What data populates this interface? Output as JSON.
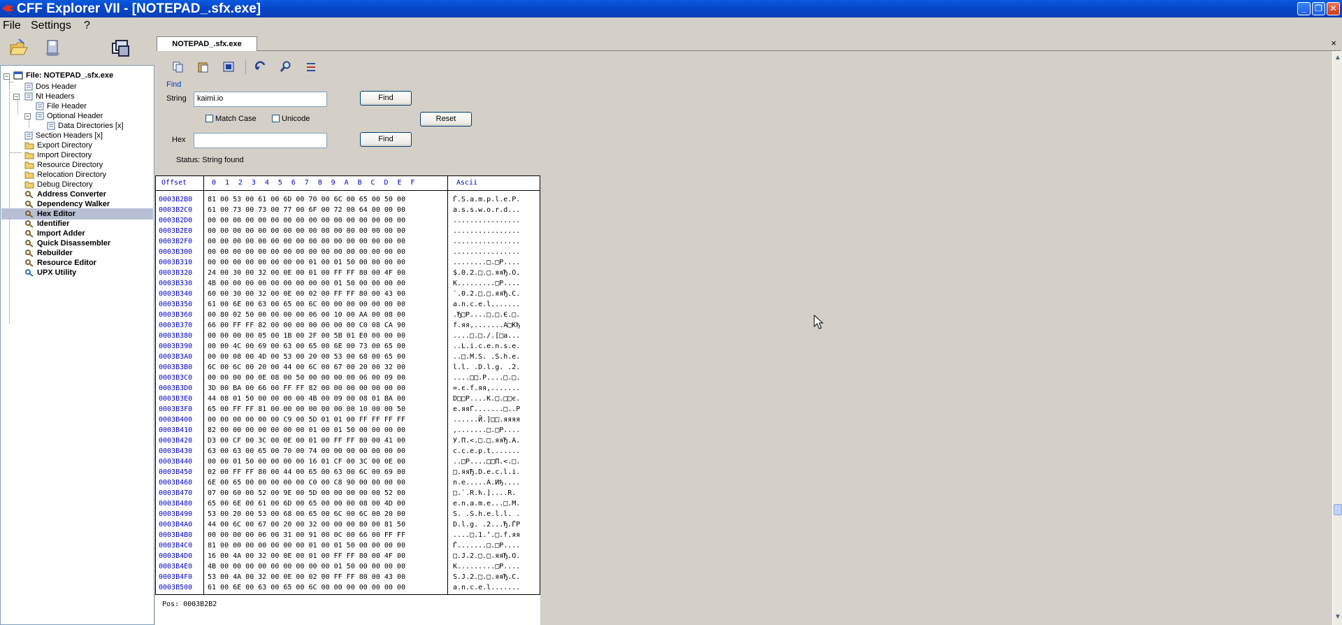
{
  "window": {
    "title": "CFF Explorer VII - [NOTEPAD_.sfx.exe]"
  },
  "menu": {
    "items": [
      "File",
      "Settings",
      "?"
    ]
  },
  "tab": {
    "label": "NOTEPAD_.sfx.exe",
    "close": "×"
  },
  "tree": {
    "root": "File: NOTEPAD_.sfx.exe",
    "items": [
      "Dos Header",
      "Nt Headers",
      "File Header",
      "Optional Header",
      "Data Directories [x]",
      "Section Headers [x]",
      "Export Directory",
      "Import Directory",
      "Resource Directory",
      "Relocation Directory",
      "Debug Directory",
      "Address Converter",
      "Dependency Walker",
      "Hex Editor",
      "Identifier",
      "Import Adder",
      "Quick Disassembler",
      "Rebuilder",
      "Resource Editor",
      "UPX Utility"
    ],
    "selected": "Hex Editor"
  },
  "find": {
    "group_label": "Find",
    "string_label": "String",
    "string_value": "kaimi.io",
    "find_label": "Find",
    "match_case_label": "Match Case",
    "unicode_label": "Unicode",
    "reset_label": "Reset",
    "hex_label": "Hex",
    "hex_value": "",
    "status": "Status: String found"
  },
  "hex": {
    "offset_header": "Offset",
    "byte_header": "0  1  2  3  4  5  6  7  8  9  A  B  C  D  E  F",
    "ascii_header": "Ascii",
    "rows": [
      {
        "offset": "0003B2B0",
        "hex": "81 00 53 00 61 00 6D 00 70 00 6C 00 65 00 50 00",
        "ascii": "Ѓ.S.a.m.p.l.e.P."
      },
      {
        "offset": "0003B2C0",
        "hex": "61 00 73 00 73 00 77 00 6F 00 72 00 64 00 00 00",
        "ascii": "a.s.s.w.o.r.d..."
      },
      {
        "offset": "0003B2D0",
        "hex": "00 00 00 00 00 00 00 00 00 00 00 00 00 00 00 00",
        "ascii": "................"
      },
      {
        "offset": "0003B2E0",
        "hex": "00 00 00 00 00 00 00 00 00 00 00 00 00 00 00 00",
        "ascii": "................"
      },
      {
        "offset": "0003B2F0",
        "hex": "00 00 00 00 00 00 00 00 00 00 00 00 00 00 00 00",
        "ascii": "................"
      },
      {
        "offset": "0003B300",
        "hex": "00 00 00 00 00 00 00 00 00 00 00 00 00 00 00 00",
        "ascii": "................"
      },
      {
        "offset": "0003B310",
        "hex": "00 00 00 00 00 00 00 00 01 00 01 50 00 00 00 00",
        "ascii": "........□.□P...."
      },
      {
        "offset": "0003B320",
        "hex": "24 00 30 00 32 00 0E 00 01 00 FF FF 80 00 4F 00",
        "ascii": "$.0.2.□.□.яяЂ.O."
      },
      {
        "offset": "0003B330",
        "hex": "4B 00 00 00 00 00 00 00 00 00 01 50 00 00 00 00",
        "ascii": "K.........□P...."
      },
      {
        "offset": "0003B340",
        "hex": "60 00 30 00 32 00 0E 00 02 00 FF FF 80 00 43 00",
        "ascii": "`.0.2.□.□.яяЂ.C."
      },
      {
        "offset": "0003B350",
        "hex": "61 00 6E 00 63 00 65 00 6C 00 00 00 00 00 00 00",
        "ascii": "a.n.c.e.l......."
      },
      {
        "offset": "0003B360",
        "hex": "00 80 02 50 00 00 00 00 06 00 10 00 AA 00 08 00",
        "ascii": ".Ђ□P....□.□.Є.□."
      },
      {
        "offset": "0003B370",
        "hex": "66 00 FF FF 82 00 00 00 00 00 00 00 C0 08 CA 90",
        "ascii": "f.яя‚.......А□Кђ"
      },
      {
        "offset": "0003B380",
        "hex": "00 00 00 00 05 00 1B 00 2F 00 5B 01 E0 00 00 00",
        "ascii": "....□.□./.[□а..."
      },
      {
        "offset": "0003B390",
        "hex": "00 00 4C 00 69 00 63 00 65 00 6E 00 73 00 65 00",
        "ascii": "..L.i.c.e.n.s.e."
      },
      {
        "offset": "0003B3A0",
        "hex": "00 00 08 00 4D 00 53 00 20 00 53 00 68 00 65 00",
        "ascii": "..□.M.S. .S.h.e."
      },
      {
        "offset": "0003B3B0",
        "hex": "6C 00 6C 00 20 00 44 00 6C 00 67 00 20 00 32 00",
        "ascii": "l.l. .D.l.g. .2."
      },
      {
        "offset": "0003B3C0",
        "hex": "00 00 00 00 0E 08 00 50 00 00 00 00 06 00 09 00",
        "ascii": "....□□.P....□.□."
      },
      {
        "offset": "0003B3D0",
        "hex": "3D 00 BA 00 66 00 FF FF 82 00 00 00 00 00 00 00",
        "ascii": "=.є.f.яя‚......."
      },
      {
        "offset": "0003B3E0",
        "hex": "44 08 01 50 00 00 00 00 4B 00 09 00 08 01 BA 00",
        "ascii": "D□□P....K.□.□□є."
      },
      {
        "offset": "0003B3F0",
        "hex": "65 00 FF FF 81 00 00 00 00 00 00 00 10 00 00 50",
        "ascii": "e.яяЃ.......□..P"
      },
      {
        "offset": "0003B400",
        "hex": "00 00 00 00 00 00 C9 00 5D 01 01 00 FF FF FF FF",
        "ascii": "......Й.]□□.яяяя"
      },
      {
        "offset": "0003B410",
        "hex": "82 00 00 00 00 00 00 00 01 00 01 50 00 00 00 00",
        "ascii": "‚.......□.□P...."
      },
      {
        "offset": "0003B420",
        "hex": "D3 00 CF 00 3C 00 0E 00 01 00 FF FF 80 00 41 00",
        "ascii": "У.П.<.□.□.яяЂ.A."
      },
      {
        "offset": "0003B430",
        "hex": "63 00 63 00 65 00 70 00 74 00 00 00 00 00 00 00",
        "ascii": "c.c.e.p.t......."
      },
      {
        "offset": "0003B440",
        "hex": "00 00 01 50 00 00 00 00 16 01 CF 00 3C 00 0E 00",
        "ascii": "..□P....□□П.<.□."
      },
      {
        "offset": "0003B450",
        "hex": "02 00 FF FF 80 00 44 00 65 00 63 00 6C 00 69 00",
        "ascii": "□.яяЂ.D.e.c.l.i."
      },
      {
        "offset": "0003B460",
        "hex": "6E 00 65 00 00 00 00 00 C0 00 C8 90 00 00 00 00",
        "ascii": "n.e.....А.Иђ...."
      },
      {
        "offset": "0003B470",
        "hex": "07 00 60 00 52 00 9E 00 5D 00 00 00 00 00 52 00",
        "ascii": "□.`.R.ћ.]....R."
      },
      {
        "offset": "0003B480",
        "hex": "65 00 6E 00 61 00 6D 00 65 00 00 00 08 00 4D 00",
        "ascii": "e.n.a.m.e...□.M."
      },
      {
        "offset": "0003B490",
        "hex": "53 00 20 00 53 00 68 00 65 00 6C 00 6C 00 20 00",
        "ascii": "S. .S.h.e.l.l. ."
      },
      {
        "offset": "0003B4A0",
        "hex": "44 00 6C 00 67 00 20 00 32 00 00 00 80 00 81 50",
        "ascii": "D.l.g. .2...Ђ.ЃP"
      },
      {
        "offset": "0003B4B0",
        "hex": "00 00 00 00 06 00 31 00 91 00 0C 00 66 00 FF FF",
        "ascii": "....□.1.‘.□.f.яя"
      },
      {
        "offset": "0003B4C0",
        "hex": "81 00 00 00 00 00 00 00 01 00 01 50 00 00 00 00",
        "ascii": "Ѓ.......□.□P...."
      },
      {
        "offset": "0003B4D0",
        "hex": "16 00 4A 00 32 00 0E 00 01 00 FF FF 80 00 4F 00",
        "ascii": "□.J.2.□.□.яяЂ.O."
      },
      {
        "offset": "0003B4E0",
        "hex": "4B 00 00 00 00 00 00 00 00 00 01 50 00 00 00 00",
        "ascii": "K.........□P...."
      },
      {
        "offset": "0003B4F0",
        "hex": "53 00 4A 00 32 00 0E 00 02 00 FF FF 80 00 43 00",
        "ascii": "S.J.2.□.□.яяЂ.C."
      },
      {
        "offset": "0003B500",
        "hex": "61 00 6E 00 63 00 65 00 6C 00 00 00 00 00 00 00",
        "ascii": "a.n.c.e.l......."
      }
    ],
    "position": "Pos: 0003B2B2"
  },
  "colors": {
    "titlebar": "#0547c9",
    "offset_text": "#0000cc",
    "selection": "#b8bfd4"
  }
}
